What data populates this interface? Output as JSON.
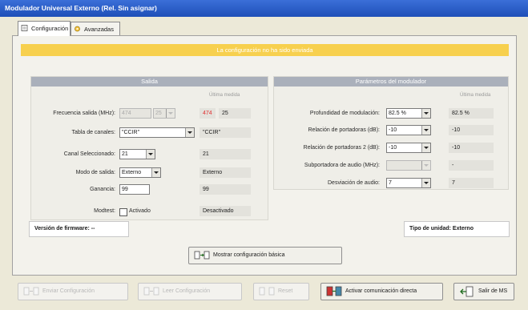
{
  "window": {
    "title": "Modulador Universal Externo (Rel. Sin asignar)"
  },
  "tabs": [
    {
      "label": "Configuración"
    },
    {
      "label": "Avanzadas"
    }
  ],
  "status_message": "La configuración no ha sido enviada",
  "salida": {
    "header": "Salida",
    "ultima_medida_header": "Última medida",
    "rows": [
      {
        "label": "Frecuencia salida (MHz):",
        "value1": "474",
        "value2": "25",
        "measured_a": "474",
        "measured_b": "25"
      },
      {
        "label": "Tabla de canales:",
        "value": "\"CCIR\"",
        "measured": "\"CCIR\""
      },
      {
        "label": "Canal Seleccionado:",
        "value": "21",
        "measured": "21"
      },
      {
        "label": "Modo de salida:",
        "value": "Externo",
        "measured": "Externo"
      },
      {
        "label": "Ganancia:",
        "value": "99",
        "measured": "99"
      }
    ],
    "modulo_label": "Modtest:",
    "modulo_checkbox_label": "Activado",
    "modulo_measured": "Desactivado"
  },
  "parametros": {
    "header": "Parámetros del modulador",
    "ultima_medida_header": "Última medida",
    "rows": [
      {
        "label": "Profundidad de modulación:",
        "value": "82.5 %",
        "measured": "82.5 %"
      },
      {
        "label": "Relación de portadoras (dB):",
        "value": "-10",
        "measured": "-10"
      },
      {
        "label": "Relación de portadoras 2 (dB):",
        "value": "-10",
        "measured": "-10"
      },
      {
        "label": "Subportadora de audio (MHz):",
        "value": "",
        "measured": "-"
      },
      {
        "label": "Desviación de audio:",
        "value": "7",
        "measured": "7"
      }
    ]
  },
  "version_firmware": "Versión de firmware: --",
  "tipo_unidad": "Tipo de unidad: Externo",
  "buttons": {
    "mostrar_config": "Mostrar configuración básica",
    "enviar_config": "Enviar Configuración",
    "leer_config": "Leer Configuración",
    "reset": "Reset",
    "activar_comunicacion": "Activar comunicación directa",
    "salir": "Salir de MS"
  }
}
